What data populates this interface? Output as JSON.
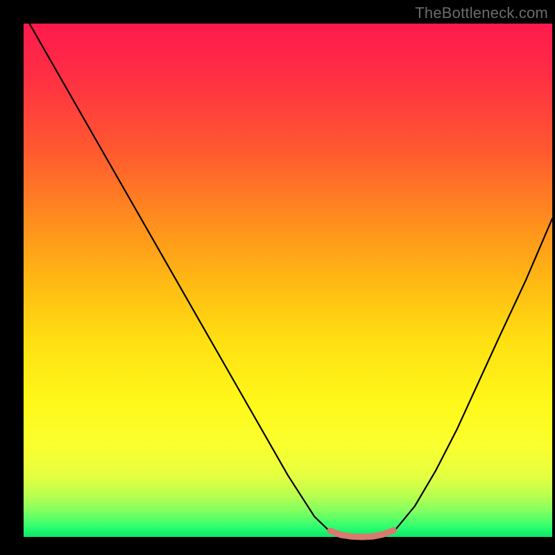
{
  "watermark": "TheBottleneck.com",
  "chart_data": {
    "type": "line",
    "title": "",
    "xlabel": "",
    "ylabel": "",
    "xlim": [
      0,
      100
    ],
    "ylim": [
      0,
      100
    ],
    "grid": false,
    "legend": false,
    "series": [
      {
        "name": "bottleneck-curve",
        "color": "#000000",
        "x": [
          0,
          5,
          10,
          15,
          20,
          25,
          30,
          35,
          40,
          45,
          50,
          55,
          58,
          62,
          66,
          70,
          74,
          78,
          82,
          86,
          90,
          95,
          100
        ],
        "values": [
          102,
          93,
          84,
          75,
          66,
          57,
          48,
          39,
          30,
          21,
          12,
          4,
          1,
          0,
          0,
          1,
          6,
          13,
          21,
          30,
          39,
          50,
          62
        ]
      },
      {
        "name": "optimal-zone",
        "color": "#d87a6e",
        "x": [
          58,
          60,
          62,
          64,
          66,
          68,
          70
        ],
        "values": [
          1.2,
          0.4,
          0.1,
          0.0,
          0.1,
          0.5,
          1.3
        ]
      }
    ],
    "annotations": []
  }
}
